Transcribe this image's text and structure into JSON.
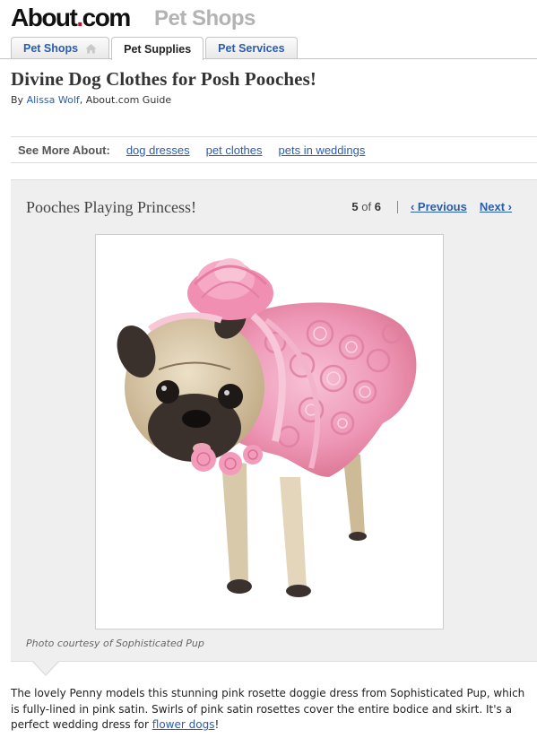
{
  "header": {
    "logo": {
      "about": "About",
      "dot": ".",
      "com": "com"
    },
    "section": "Pet Shops"
  },
  "tabs": [
    {
      "label": "Pet Shops",
      "icon": "home-icon",
      "active": false
    },
    {
      "label": "Pet Supplies",
      "active": true
    },
    {
      "label": "Pet Services",
      "active": false
    }
  ],
  "article": {
    "title": "Divine Dog Clothes for Posh Pooches!",
    "byline_prefix": "By",
    "author": "Alissa Wolf",
    "byline_suffix": ", About.com Guide"
  },
  "see_more": {
    "label": "See More About:",
    "links": [
      "dog dresses",
      "pet clothes",
      "pets in weddings"
    ]
  },
  "slideshow": {
    "title": "Pooches Playing Princess!",
    "current": "5",
    "of": "of",
    "total": "6",
    "previous": "Previous",
    "next": "Next",
    "caption": "Photo courtesy of Sophisticated Pup"
  },
  "description": {
    "text_before": "The lovely Penny models this stunning pink rosette doggie dress from Sophisticated Pup, which is fully-lined in pink satin. Swirls of pink satin rosettes cover the entire bodice and skirt. It's a perfect wedding dress for ",
    "link": "flower dogs",
    "text_after": "!"
  },
  "colors": {
    "link": "#2a5db0",
    "logo_dot": "#c8102e",
    "dress_pink": "#f2a2c0",
    "pug_fawn": "#d9c6a4"
  }
}
